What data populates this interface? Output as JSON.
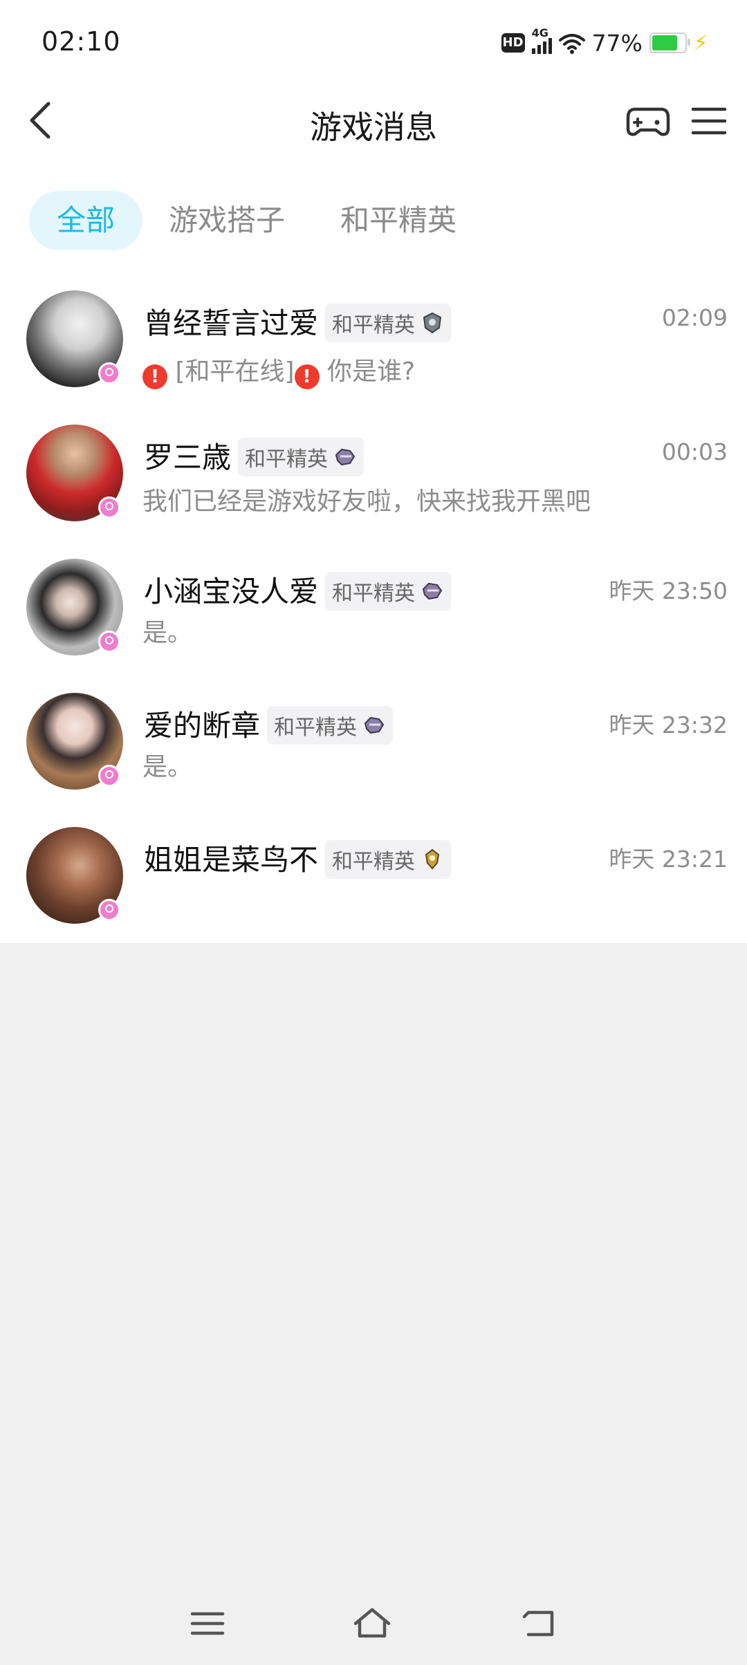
{
  "status": {
    "time": "02:10",
    "hd": "HD",
    "network": "4G",
    "battery": "77%"
  },
  "header": {
    "title": "游戏消息"
  },
  "tabs": [
    {
      "label": "全部",
      "active": true
    },
    {
      "label": "游戏搭子",
      "active": false
    },
    {
      "label": "和平精英",
      "active": false
    }
  ],
  "messages": [
    {
      "name": "曾经誓言过爱",
      "game": "和平精英",
      "time": "02:09",
      "preview_tag": "[和平在线]",
      "preview": "你是谁?"
    },
    {
      "name": "罗三歳",
      "game": "和平精英",
      "time": "00:03",
      "preview": "我们已经是游戏好友啦，快来找我开黑吧"
    },
    {
      "name": "小涵宝没人爱",
      "game": "和平精英",
      "time": "昨天 23:50",
      "preview": "是。"
    },
    {
      "name": "爱的断章",
      "game": "和平精英",
      "time": "昨天 23:32",
      "preview": "是。"
    },
    {
      "name": "姐姐是菜鸟不",
      "game": "和平精英",
      "time": "昨天 23:21",
      "preview": ""
    }
  ],
  "colors": {
    "accent": "#19b9e6",
    "tab_active_bg": "#e3f6fb",
    "badge": "#f07ccf",
    "alert": "#ef3b2c"
  },
  "icons": [
    "back-icon",
    "gamepad-icon",
    "menu-icon",
    "rank-icon",
    "gender-badge-icon",
    "nav-menu-icon",
    "nav-home-icon",
    "nav-back-icon"
  ]
}
